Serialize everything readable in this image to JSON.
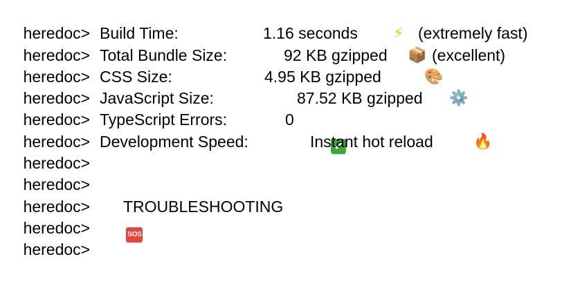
{
  "prompt": "heredoc>",
  "rows": [
    {},
    {
      "label": "Build Time:",
      "value": "1.16 seconds",
      "icon": "⚡",
      "icon_name": "lightning-icon",
      "note": "(extremely fast)"
    },
    {
      "label": "Total Bundle Size:",
      "value": "92 KB gzipped",
      "icon": "📦",
      "icon_name": "package-icon",
      "note": "(excellent)"
    },
    {
      "label": "CSS Size:",
      "value": "4.95 KB gzipped",
      "icon": "🎨",
      "icon_name": "palette-icon"
    },
    {
      "label": "JavaScript Size:",
      "value": "87.52 KB gzipped",
      "icon": "⚙️",
      "icon_name": "gear-icon"
    },
    {
      "label": "TypeScript Errors:",
      "value": "0",
      "icon": "✔",
      "icon_name": "check-mark-icon"
    },
    {
      "label": "Development Speed:",
      "value": "Instant hot reload",
      "icon": "🔥",
      "icon_name": "fire-icon"
    },
    {},
    {},
    {
      "icon": "SOS",
      "icon_name": "sos-icon",
      "label": "TROUBLESHOOTING"
    },
    {}
  ]
}
